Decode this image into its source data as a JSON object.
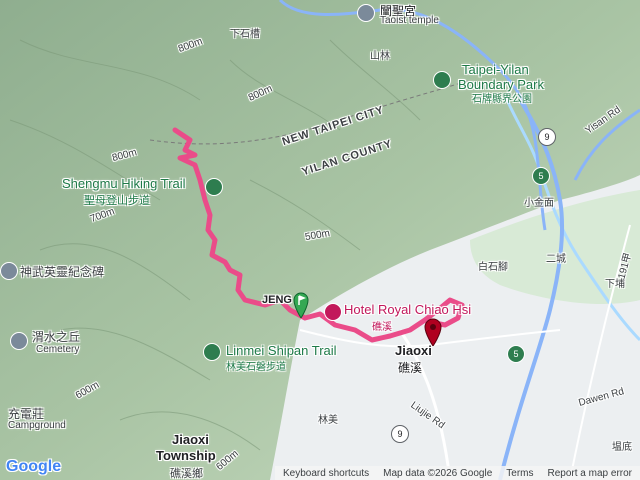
{
  "map": {
    "labels": {
      "taoist_temple_cn": "闡聖宮",
      "taoist_temple_en": "Taoist temple",
      "xiashicao": "下石槽",
      "shanlin": "山林",
      "boundary_park_en_1": "Taipei-Yilan",
      "boundary_park_en_2": "Boundary Park",
      "boundary_park_cn": "石牌縣界公園",
      "new_taipei": "NEW TAIPEI CITY",
      "yilan_county": "YILAN COUNTY",
      "shengmu_trail_en": "Shengmu Hiking Trail",
      "shengmu_trail_cn": "聖母登山步道",
      "xiaojinmian": "小金面",
      "yisan_rd": "Yisan Rd",
      "shenwu_cn": "神武英靈紀念碑",
      "baishijiao": "白石腳",
      "ercheng": "二城",
      "xiapu": "下埔",
      "route_191": "191甲",
      "weishui_cn": "渭水之丘",
      "cemetery": "Cemetery",
      "hotel_en": "Hotel Royal Chiao Hsi",
      "hotel_cn": "礁溪",
      "linmei_trail_en": "Linmei Shipan Trail",
      "linmei_trail_cn": "林美石磐步道",
      "jiaoxi_en": "Jiaoxi",
      "jiaoxi_cn": "礁溪",
      "dawen_rd": "Dawen Rd",
      "linmei": "林美",
      "liujie_rd": "Liujie Rd",
      "chongdian_cn": "充電莊",
      "campground": "Campground",
      "jiaoxi_township_en": "Jiaoxi",
      "township": "Township",
      "jiaoxi_township_cn": "礁溪鄉",
      "tangwei": "塭底",
      "partial_label": "JENG"
    },
    "shields": {
      "hw9_top": "9",
      "hw5_top": "5",
      "hw5_right": "5",
      "hw9_bottom": "9"
    },
    "elevations": [
      "800m",
      "800m",
      "800m",
      "500m",
      "700m",
      "600m",
      "600m"
    ],
    "icon_names": {
      "temple": "temple-icon",
      "park": "tree-icon",
      "trail": "hiker-icon",
      "memorial": "landmark-icon",
      "hotel": "hotel-icon",
      "cemetery": "cemetery-icon",
      "start": "start-flag-icon",
      "end": "end-pin-icon"
    },
    "colors": {
      "track": "#ea4c89",
      "start_marker": "#34a853",
      "end_marker": "#b00020",
      "water": "#aadaff",
      "highway": "#8ab4f8"
    }
  },
  "footer": {
    "logo": "Google",
    "keyboard": "Keyboard shortcuts",
    "map_data": "Map data ©2026 Google",
    "terms": "Terms",
    "report": "Report a map error"
  }
}
